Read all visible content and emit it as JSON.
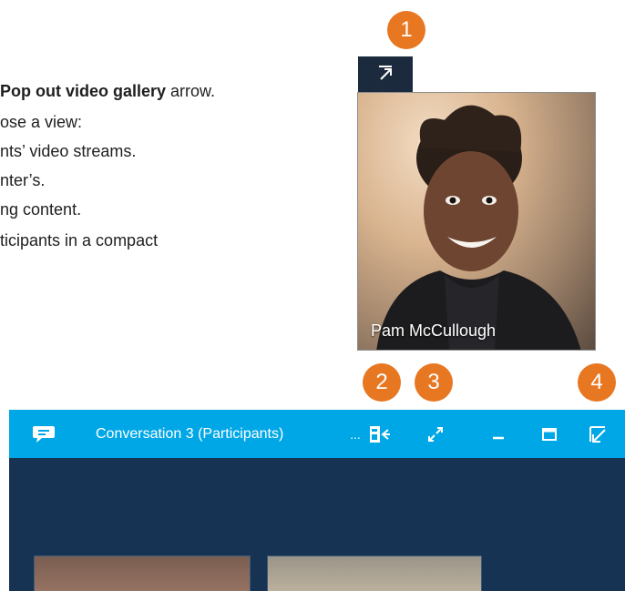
{
  "instructions": {
    "line1_bold": "Pop out video gallery",
    "line1_rest": " arrow.",
    "line2": "ose a view:",
    "line3": "nts’ video streams.",
    "line4": "nter’s.",
    "line5": "ng content.",
    "line6": "ticipants in a compact"
  },
  "callouts": [
    "1",
    "2",
    "3",
    "4"
  ],
  "video_tile": {
    "participant_name": "Pam McCullough"
  },
  "window": {
    "title": "Conversation 3 (Participants)",
    "more_label": "...",
    "icons": [
      "chat-icon",
      "more-options-icon",
      "content-view-icon",
      "full-screen-icon",
      "minimize-icon",
      "maximize-icon",
      "pop-in-icon"
    ]
  },
  "colors": {
    "accent": "#e87722",
    "titlebar": "#00a7e6",
    "stage": "#163353",
    "popout_tab": "#1b2a3d"
  }
}
